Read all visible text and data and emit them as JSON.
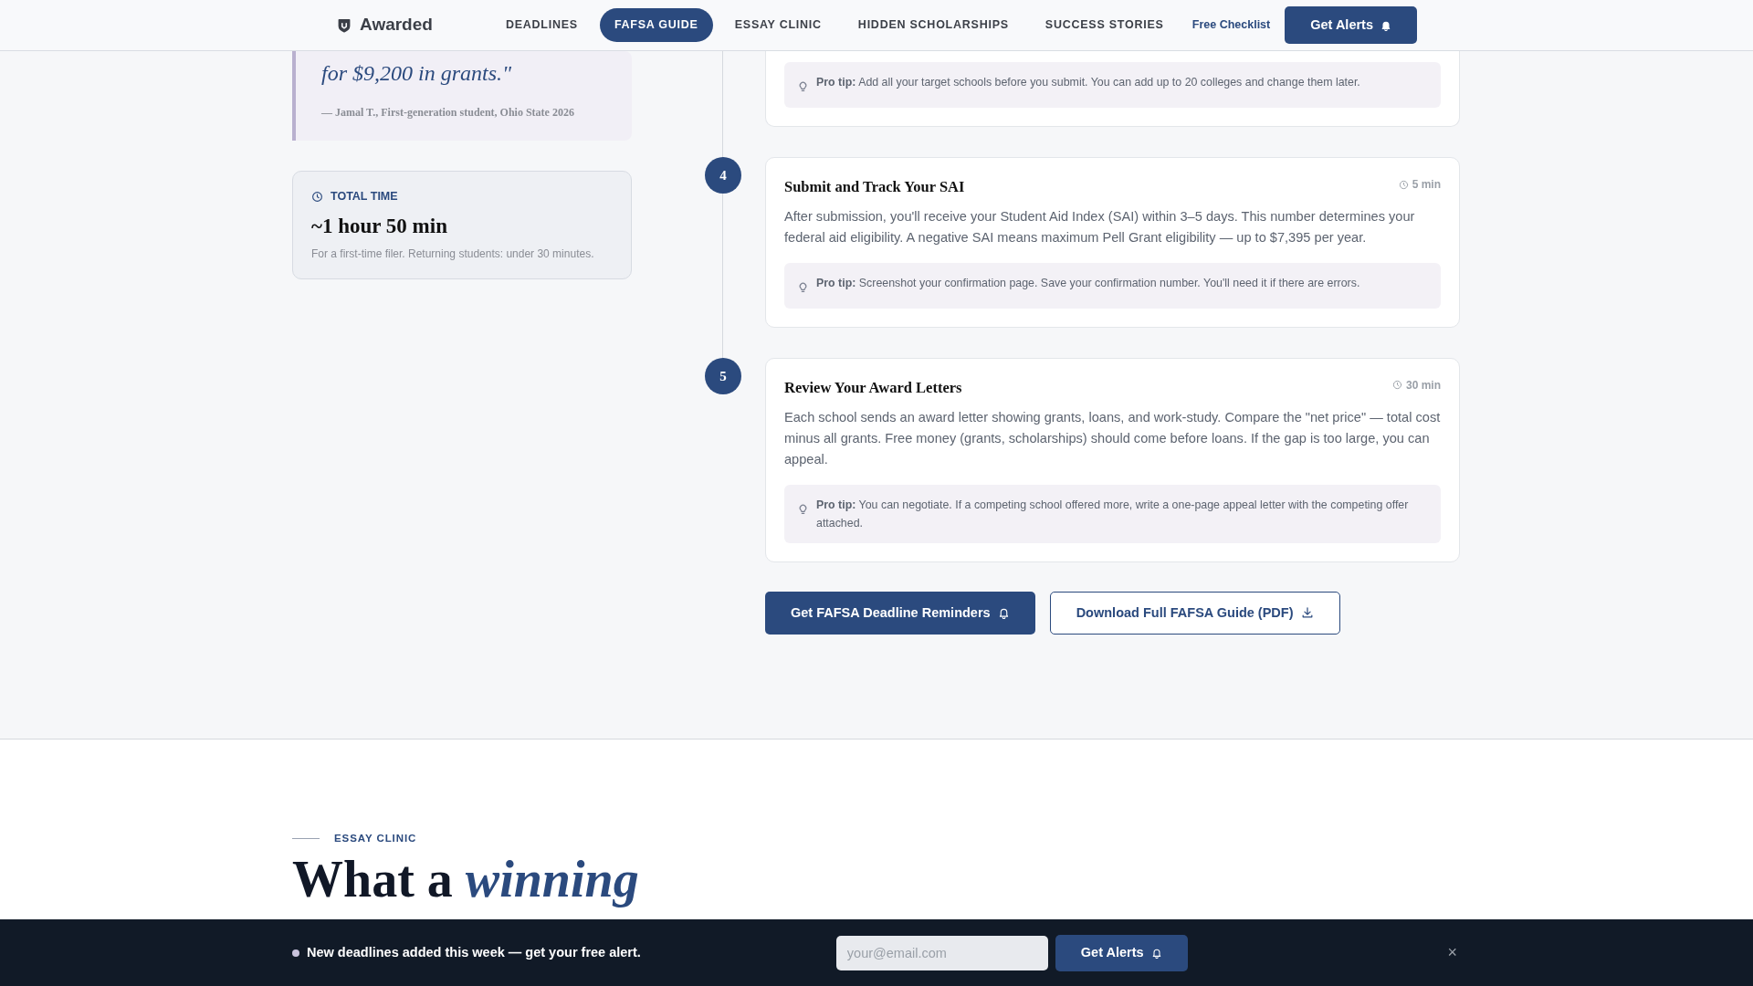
{
  "header": {
    "brand": "Awarded",
    "nav": [
      {
        "label": "DEADLINES",
        "selected": false
      },
      {
        "label": "FAFSA GUIDE",
        "selected": true
      },
      {
        "label": "ESSAY CLINIC",
        "selected": false
      },
      {
        "label": "HIDDEN SCHOLARSHIPS",
        "selected": false
      },
      {
        "label": "SUCCESS STORIES",
        "selected": false
      }
    ],
    "link": "Free Checklist",
    "button": "Get Alerts"
  },
  "quote": {
    "text": "for $9,200 in grants.\"",
    "attribution": "— Jamal T., First-generation student, Ohio State 2026"
  },
  "total_time": {
    "label": "TOTAL TIME",
    "value": "~1 hour 50 min",
    "note": "For a first-time filer. Returning students: under 30 minutes."
  },
  "steps": [
    {
      "tip": "**Pro tip:** Add all your target schools before you submit. You can add up to 20 colleges and change them later."
    },
    {
      "number": "4",
      "title": "Submit and Track Your SAI",
      "time": "5 min",
      "body": "After submission, you'll receive your Student Aid Index (SAI) within 3–5 days. This number determines your federal aid eligibility. A negative SAI means maximum Pell Grant eligibility — up to $7,395 per year.",
      "tip": "**Pro tip:** Screenshot your confirmation page. Save your confirmation number. You'll need it if there are errors."
    },
    {
      "number": "5",
      "title": "Review Your Award Letters",
      "time": "30 min",
      "body": "Each school sends an award letter showing grants, loans, and work-study. Compare the \"net price\" — total cost minus all grants. Free money (grants, scholarships) should come before loans. If the gap is too large, you can appeal.",
      "tip": "**Pro tip:** You can negotiate. If a competing school offered more, write a one-page appeal letter with the competing offer attached."
    }
  ],
  "actions": [
    {
      "label": "Get FAFSA Deadline Reminders",
      "kind": "primary"
    },
    {
      "label": "Download Full FAFSA Guide (PDF)",
      "kind": "outline"
    }
  ],
  "next_section": {
    "eyebrow": "ESSAY CLINIC",
    "heading": "What a *winning*"
  },
  "alert_bar": {
    "message": "New deadlines added this week — get your free alert.",
    "placeholder": "your@email.com",
    "button": "Get Alerts",
    "close": "×"
  }
}
